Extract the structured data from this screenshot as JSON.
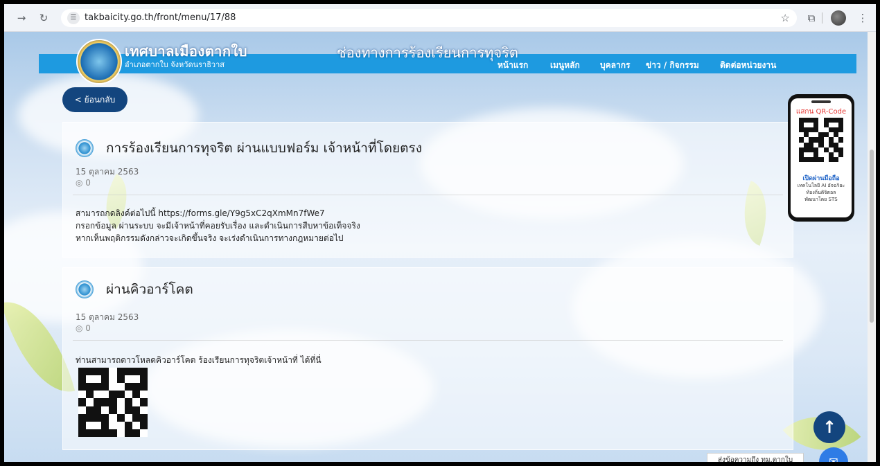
{
  "browser": {
    "url": "takbaicity.go.th/front/menu/17/88",
    "site_info_icon": "tune-icon",
    "star_icon": "bookmark-star-icon"
  },
  "header": {
    "logo_title": "เทศบาลเมืองตากใบ",
    "logo_subtitle": "อำเภอตากใบ จังหวัดนราธิวาส",
    "banner": "ช่องทางการร้องเรียนการทุจริต",
    "nav": [
      "หน้าแรก",
      "เมนูหลัก",
      "บุคลากร",
      "ข่าว / กิจกรรม",
      "ติดต่อหน่วยงาน"
    ]
  },
  "back_button": "< ย้อนกลับ",
  "articles": [
    {
      "title": "การร้องเรียนการทุจริต ผ่านแบบฟอร์ม เจ้าหน้าที่โดยตรง",
      "date": "15 ตุลาคม 2563",
      "views": "0",
      "body": [
        "สามารถกดลิงค์ต่อไปนี้ https://forms.gle/Y9g5xC2qXmMn7fWe7",
        "กรอกข้อมูล  ผ่านระบบ จะมีเจ้าหน้าที่คอยรับเรื่อง และดำเนินการสืบหาข้อเท็จจริง",
        "หากเห็นพฤติกรรมดังกล่าวจะเกิดขึ้นจริง จะเร่งดำเนินการทางกฎหมายต่อไป"
      ]
    },
    {
      "title": "ผ่านคิวอาร์โคต",
      "date": "15 ตุลาคม 2563",
      "views": "0",
      "body": [
        "ท่านสามารถดาวโหลดคิวอาร์โคต ร้องเรียนการทุจริตเจ้าหน้าที่ ได้ที่นี่"
      ]
    }
  ],
  "phone_widget": {
    "scan_label": "แสกน QR-Code",
    "open_label": "เปิดผ่านมือถือ",
    "line1": "เทคโนโลยี AI อัจฉริยะ",
    "line2": "ท้องถิ่นดิจิตอล",
    "line3": "พัฒนาโดย STS"
  },
  "messenger_tooltip": "ส่งข้อความถึง ทม.ตากใบ",
  "colors": {
    "navbar": "#1e9ae0",
    "back_button": "#13457e",
    "scroll_top": "#13457e",
    "messenger": "#2f7ce6"
  }
}
